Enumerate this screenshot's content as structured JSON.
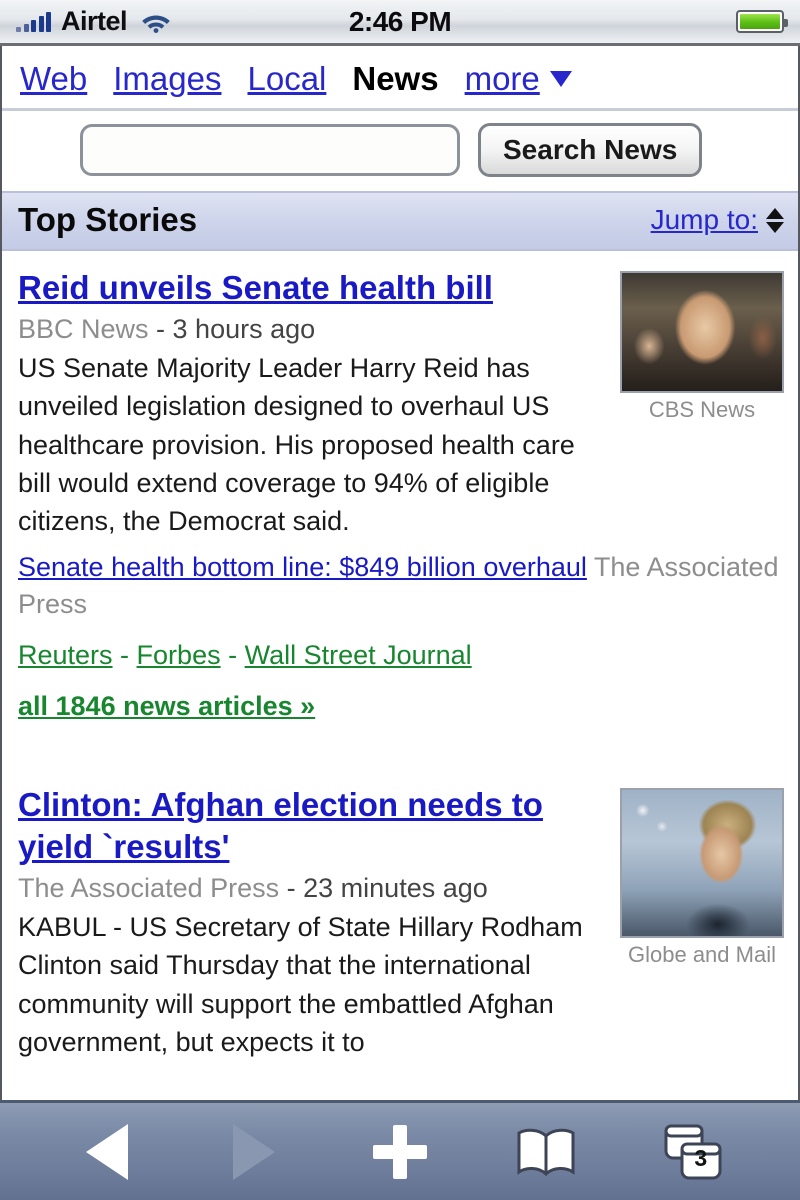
{
  "statusbar": {
    "carrier": "Airtel",
    "time": "2:46 PM",
    "signal_icon": "signal-bars-icon",
    "wifi_icon": "wifi-icon",
    "battery_icon": "battery-full-icon"
  },
  "nav": {
    "items": [
      {
        "label": "Web",
        "active": false
      },
      {
        "label": "Images",
        "active": false
      },
      {
        "label": "Local",
        "active": false
      },
      {
        "label": "News",
        "active": true
      }
    ],
    "more_label": "more"
  },
  "search": {
    "value": "",
    "placeholder": "",
    "button_label": "Search News"
  },
  "section": {
    "title": "Top Stories",
    "jump_label": "Jump to:"
  },
  "stories": [
    {
      "headline": "Reid unveils Senate health bill",
      "source": "BBC News",
      "separator": " - ",
      "time": "3 hours ago",
      "snippet": "US Senate Majority Leader Harry Reid has unveiled legislation designed to overhaul US healthcare provision. His proposed health care bill would extend coverage to 94% of eligible citizens, the Democrat said.",
      "thumb_caption": "CBS News",
      "related": {
        "link": "Senate health bottom line: $849 billion overhaul",
        "source": "The Associated Press"
      },
      "sources": [
        "Reuters",
        "Forbes",
        "Wall Street Journal"
      ],
      "source_separator": " - ",
      "all_articles": "all 1846 news articles »"
    },
    {
      "headline": "Clinton: Afghan election needs to yield `results'",
      "source": "The Associated Press",
      "separator": " - ",
      "time": "23 minutes ago",
      "snippet": "KABUL - US Secretary of State Hillary Rodham Clinton said Thursday that the international community will support the embattled Afghan government, but expects it to",
      "thumb_caption": "Globe and Mail"
    }
  ],
  "toolbar": {
    "back_label": "Back",
    "forward_label": "Forward",
    "add_label": "Add",
    "bookmarks_label": "Bookmarks",
    "tabs_count": "3"
  },
  "colors": {
    "link_blue": "#1a1ac4",
    "source_green": "#17862f",
    "meta_gray": "#8d8d8d",
    "section_bar": "#ccd3ea"
  }
}
